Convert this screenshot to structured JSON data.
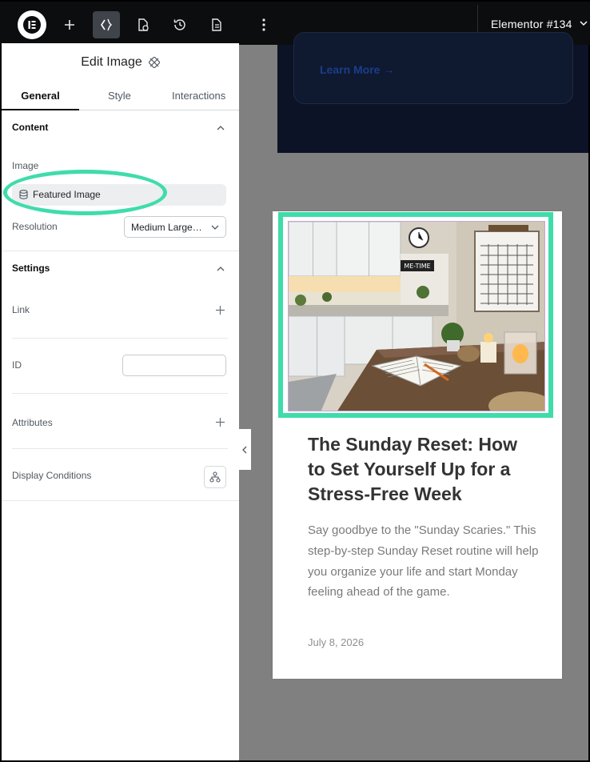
{
  "topbar": {
    "document_title": "Elementor #134"
  },
  "panel": {
    "title": "Edit Image",
    "tabs": [
      "General",
      "Style",
      "Interactions"
    ],
    "content_section": {
      "heading": "Content",
      "image_label": "Image",
      "image_value": "Featured Image",
      "resolution_label": "Resolution",
      "resolution_value": "Medium Large…"
    },
    "settings_section": {
      "heading": "Settings",
      "link_label": "Link",
      "id_label": "ID",
      "id_value": "",
      "attributes_label": "Attributes",
      "display_conditions_label": "Display Conditions"
    }
  },
  "canvas": {
    "cta_link": "Learn More  →",
    "post": {
      "title": "The Sunday Reset: How to Set Yourself Up for a Stress-Free Week",
      "excerpt": "Say goodbye to the \"Sunday Scaries.\" This step-by-step Sunday Reset routine will help you organize your life and start Monday feeling ahead of the game.",
      "date": "July 8, 2026",
      "image_sign": "ME-TIME"
    }
  },
  "colors": {
    "highlight": "#3fdcab",
    "topbar_bg": "#0c0d0e",
    "canvas_bg": "#808080",
    "dark_section": "#0c1326"
  }
}
